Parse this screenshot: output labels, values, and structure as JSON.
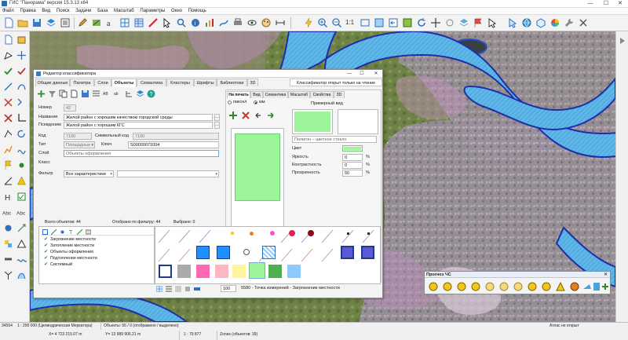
{
  "app": {
    "title": "ГИС \"Панорама\" версия 15.3.13 x64",
    "window_controls": [
      "—",
      "☐",
      "✕"
    ]
  },
  "menu": [
    "Файл",
    "Правка",
    "Вид",
    "Поиск",
    "Задачи",
    "База",
    "Масштаб",
    "Параметры",
    "Окно",
    "Помощь"
  ],
  "toolbar": {
    "zoom_ratio_label": "1:1"
  },
  "dialog": {
    "title": "Редактор классификатора",
    "controls": [
      "—",
      "☐",
      "✕"
    ],
    "tabs": [
      "Общие данные",
      "Палитра",
      "Слои",
      "Объекты",
      "Семантика",
      "Кластеры",
      "Шрифты",
      "Библиотеки",
      "3D"
    ],
    "active_tab": "Объекты",
    "notice": "Классификатор открыт только на чтение",
    "fields": {
      "number_label": "Номер",
      "number_value": "42",
      "name_label": "Название",
      "name_value": "Жилой район с хорошим качеством городской среды",
      "alias_label": "Псевдоним",
      "alias_value": "Жилой район с хорошим КГС",
      "code_label": "Код",
      "code_value": "7100",
      "symbolic_code_label": "Символьный код",
      "symbolic_code_value": "7100",
      "type_label": "Тип",
      "type_value": "Площадные",
      "key_label": "Ключ",
      "key_value": "S00000071004",
      "layer_label": "Слой",
      "layer_value": "Объекты оформления",
      "class_label": "Класс",
      "filter_label": "Фильтр",
      "filter_value": "Все характеристики"
    },
    "right_panel": {
      "subtabs": [
        "На печать",
        "Вид",
        "Семантика",
        "Масштаб",
        "Свойства",
        "3D"
      ],
      "active_subtab": "На печать",
      "radio_pixel": "пиксел",
      "radio_mm": "мм",
      "example_label": "Примерный вид",
      "style_value": "Полигон – цветное стекло",
      "color_label": "Цвет",
      "color_value": "#9cf59b",
      "brightness_label": "Яркость",
      "brightness_value": "0",
      "contrast_label": "Контрастность",
      "contrast_value": "0",
      "transparency_label": "Прозрачность",
      "transparency_value": "50",
      "percent": "%"
    },
    "counts": {
      "total": "Всего объектов: 44",
      "filtered": "Отобрано по фильтру: 44",
      "selected": "Выбрано: 0"
    },
    "layers": [
      "Загрязнение местности",
      "Затопление местности",
      "Объекты оформления",
      "Подтопление местности",
      "Системный"
    ],
    "footer": {
      "size_value": "100",
      "object_info": "5580 - Точка измерений - Загрязнение местности"
    },
    "swatch_colors": [
      "#1e90ff",
      "#aaaaaa",
      "#ff69b4",
      "#ffb6c1",
      "#fff59d",
      "#9cf59b",
      "#4caf50",
      "#8ec9ff",
      "#1e3a8a",
      "#5a5ad6"
    ]
  },
  "forecast_panel": {
    "title": "Прогноз ЧС"
  },
  "status": {
    "scale": "1 : 200 000 (Цилиндрическая Меркатора)",
    "objects": "Объекты: 56 / 0 (отображено / выделено)",
    "atlas": "Атлас не открыт",
    "coords_x": "X= 4 723 215.07 m",
    "coords_y": "Y= 13 989 906.21 m",
    "ratio": "1 : 79 877",
    "zones": "Zones (объектов: 39)",
    "id": "34554"
  }
}
